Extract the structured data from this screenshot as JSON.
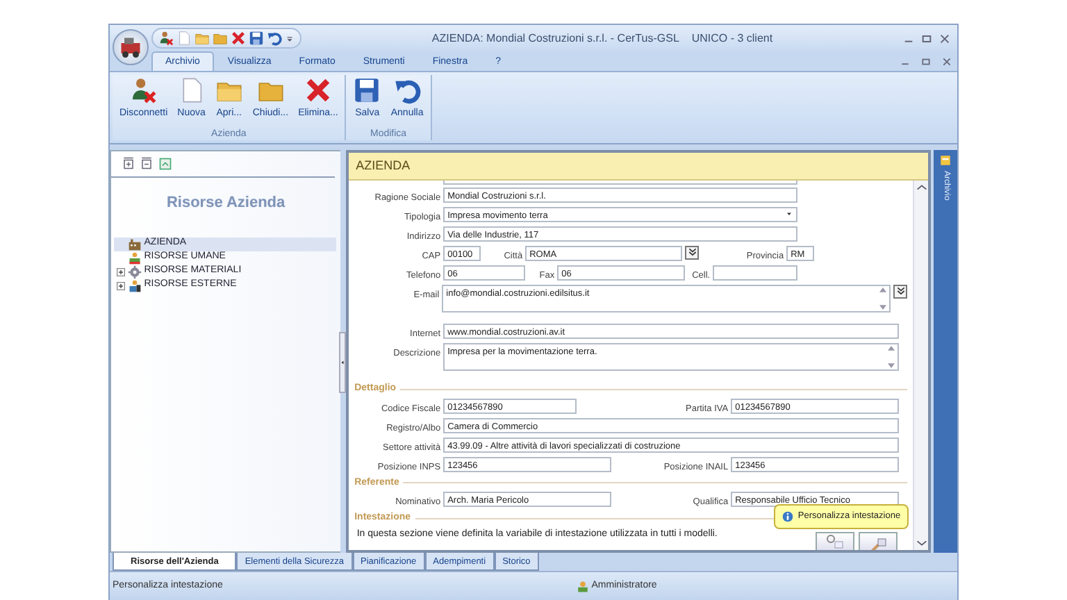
{
  "window": {
    "title": "AZIENDA: Mondial Costruzioni s.r.l. - CerTus-GSL",
    "subtitle": "UNICO - 3 client"
  },
  "menu_tabs": [
    {
      "label": "Archivio",
      "selected": true
    },
    {
      "label": "Visualizza",
      "selected": false
    },
    {
      "label": "Formato",
      "selected": false
    },
    {
      "label": "Strumenti",
      "selected": false
    },
    {
      "label": "Finestra",
      "selected": false
    },
    {
      "label": "?",
      "selected": false
    }
  ],
  "ribbon_groups": [
    {
      "label": "Azienda",
      "buttons": [
        {
          "label": "Disconnetti",
          "kind": "disconnect"
        },
        {
          "label": "Nuova",
          "kind": "new"
        },
        {
          "label": "Apri...",
          "kind": "open"
        },
        {
          "label": "Chiudi...",
          "kind": "close"
        },
        {
          "label": "Elimina...",
          "kind": "delete"
        }
      ]
    },
    {
      "label": "Modifica",
      "buttons": [
        {
          "label": "Salva",
          "kind": "save"
        },
        {
          "label": "Annulla",
          "kind": "undo"
        }
      ]
    }
  ],
  "left_panel": {
    "title": "Risorse Azienda",
    "tree": [
      {
        "label": "AZIENDA",
        "selected": true,
        "collapsed": false,
        "kind": "company"
      },
      {
        "label": "RISORSE UMANE",
        "selected": false,
        "collapsed": false,
        "kind": "people"
      },
      {
        "label": "RISORSE MATERIALI",
        "selected": false,
        "collapsed": true,
        "kind": "gear"
      },
      {
        "label": "RISORSE ESTERNE",
        "selected": false,
        "collapsed": true,
        "kind": "external"
      }
    ]
  },
  "form": {
    "header": "AZIENDA",
    "sections": [
      {
        "rows": [
          {
            "fields": [
              {
                "label": "Ragione Sociale",
                "value": "Mondial Costruzioni s.r.l.",
                "kind": "text"
              }
            ]
          },
          {
            "fields": [
              {
                "label": "Tipologia",
                "value": "Impresa movimento terra",
                "kind": "select"
              }
            ]
          },
          {
            "fields": [
              {
                "label": "Indirizzo",
                "value": "Via delle Industrie, 117",
                "kind": "text"
              }
            ]
          },
          {
            "fields": [
              {
                "label": "CAP",
                "value": "00100",
                "kind": "text"
              },
              {
                "label": "Città",
                "value": "ROMA",
                "kind": "lookup"
              },
              {
                "label": "Provincia",
                "value": "RM",
                "kind": "text"
              }
            ]
          },
          {
            "fields": [
              {
                "label": "Telefono",
                "value": "06",
                "kind": "text"
              },
              {
                "label": "Fax",
                "value": "06",
                "kind": "text"
              },
              {
                "label": "Cell.",
                "kind": "text"
              }
            ]
          },
          {
            "fields": [
              {
                "label": "E-mail",
                "value": "info@mondial.costruzioni.edilsitus.it",
                "kind": "textarea_lookup"
              }
            ]
          },
          {
            "fields": [
              {
                "label": "Internet",
                "value": "www.mondial.costruzioni.av.it",
                "kind": "text"
              }
            ]
          },
          {
            "fields": [
              {
                "label": "Descrizione",
                "value": "Impresa per la movimentazione terra.",
                "kind": "textarea"
              }
            ]
          }
        ]
      },
      {
        "title": "Dettaglio",
        "rows": [
          {
            "fields": [
              {
                "label": "Codice Fiscale",
                "value": "01234567890",
                "kind": "text"
              },
              {
                "label": "Partita IVA",
                "value": "01234567890",
                "kind": "text"
              }
            ]
          },
          {
            "fields": [
              {
                "label": "Registro/Albo",
                "value": "Camera di Commercio",
                "kind": "text"
              }
            ]
          },
          {
            "fields": [
              {
                "label": "Settore attività",
                "value": "43.99.09 - Altre attività di lavori specializzati di costruzione",
                "kind": "text"
              }
            ]
          },
          {
            "fields": [
              {
                "label": "Posizione INPS",
                "value": "123456",
                "kind": "text"
              },
              {
                "label": "Posizione INAIL",
                "value": "123456",
                "kind": "text"
              }
            ]
          }
        ]
      },
      {
        "title": "Referente",
        "rows": [
          {
            "fields": [
              {
                "label": "Nominativo",
                "value": "Arch. Maria Pericolo",
                "kind": "text"
              },
              {
                "label": "Qualifica",
                "value": "Responsabile Ufficio Tecnico",
                "kind": "text"
              }
            ]
          }
        ]
      },
      {
        "title": "Intestazione",
        "text": "In questa sezione viene definita la variabile di intestazione utilizzata in tutti i modelli."
      }
    ],
    "tooltip": "Personalizza intestazione"
  },
  "side_strip": {
    "label": "Archivio"
  },
  "bottom_tabs": [
    {
      "label": "Risorse dell'Azienda",
      "selected": true
    },
    {
      "label": "Elementi della Sicurezza",
      "selected": false
    },
    {
      "label": "Pianificazione",
      "selected": false
    },
    {
      "label": "Adempimenti",
      "selected": false
    },
    {
      "label": "Storico",
      "selected": false
    }
  ],
  "status_bar": {
    "message": "Personalizza intestazione",
    "user": "Amministratore"
  }
}
